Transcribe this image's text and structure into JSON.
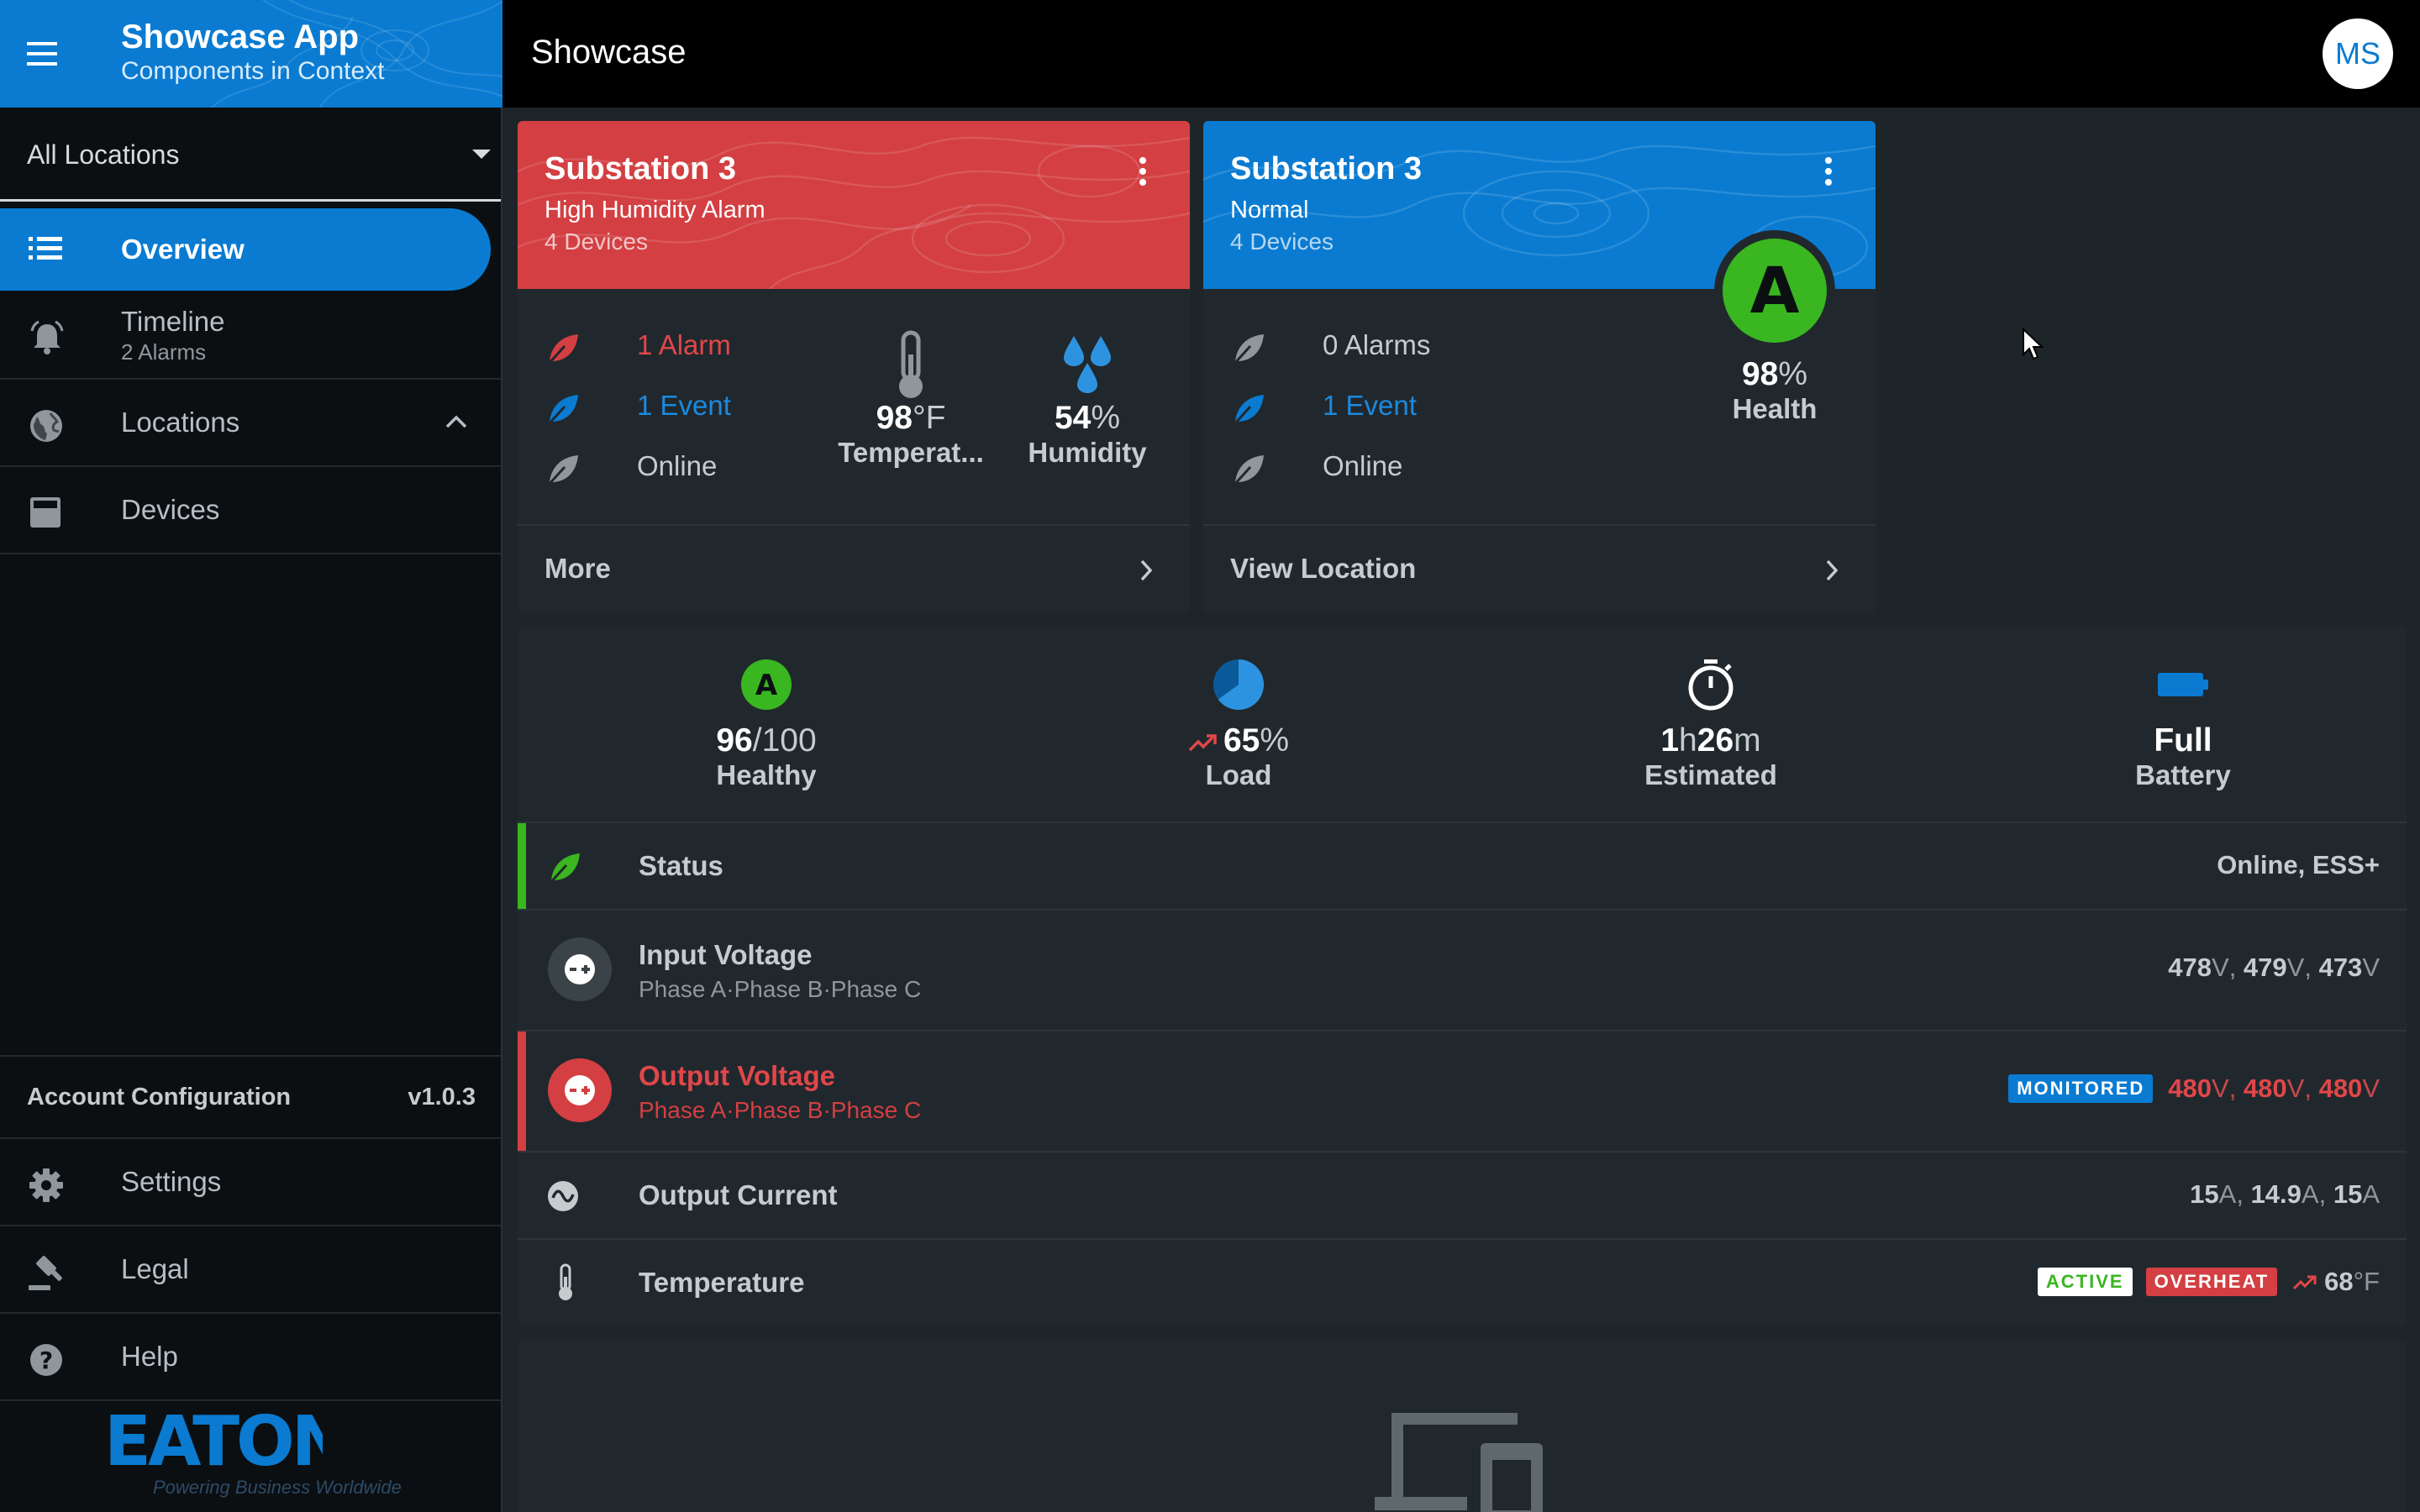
{
  "app": {
    "title": "Showcase App",
    "subtitle": "Components in Context",
    "page_title": "Showcase",
    "avatar_initials": "MS"
  },
  "sidebar": {
    "location_select": "All Locations",
    "items": [
      {
        "label": "Overview",
        "icon": "list-icon",
        "active": true
      },
      {
        "label": "Timeline",
        "sub": "2 Alarms",
        "icon": "alarm-bell-icon"
      },
      {
        "label": "Locations",
        "icon": "globe-icon"
      },
      {
        "label": "Devices",
        "icon": "device-icon"
      }
    ],
    "account_label": "Account Configuration",
    "version": "v1.0.3",
    "footer_items": [
      {
        "label": "Settings",
        "icon": "gear-icon"
      },
      {
        "label": "Legal",
        "icon": "gavel-icon"
      },
      {
        "label": "Help",
        "icon": "help-icon"
      }
    ],
    "logo_text": "EATON",
    "logo_tagline": "Powering Business Worldwide"
  },
  "cards": [
    {
      "title": "Substation 3",
      "subtitle": "High Humidity Alarm",
      "devices": "4 Devices",
      "rows": [
        "1 Alarm",
        "1 Event",
        "Online"
      ],
      "metrics": [
        {
          "value": "98",
          "unit": "°F",
          "label": "Temperat..."
        },
        {
          "value": "54",
          "unit": "%",
          "label": "Humidity"
        }
      ],
      "footer": "More"
    },
    {
      "title": "Substation 3",
      "subtitle": "Normal",
      "devices": "4 Devices",
      "rows": [
        "0 Alarms",
        "1 Event",
        "Online"
      ],
      "grade": "A",
      "health_value": "98",
      "health_unit": "%",
      "health_label": "Health",
      "footer": "View Location"
    }
  ],
  "kpis": [
    {
      "value": "96",
      "unit": "/100",
      "label": "Healthy",
      "icon": "grade-a-icon",
      "grade": "A"
    },
    {
      "value": "65",
      "unit": "%",
      "label": "Load",
      "icon": "pie-icon",
      "load_fraction": 0.65
    },
    {
      "value1": "1",
      "unit1": "h",
      "value2": "26",
      "unit2": "m",
      "label": "Estimated",
      "icon": "timer-icon"
    },
    {
      "value": "Full",
      "label": "Battery",
      "icon": "battery-icon"
    }
  ],
  "list": {
    "status": {
      "title": "Status",
      "value": "Online, ESS+"
    },
    "input_voltage": {
      "title": "Input Voltage",
      "sub": "Phase A·Phase B·Phase C",
      "v": [
        "478",
        "479",
        "473"
      ],
      "unit": "V"
    },
    "output_voltage": {
      "title": "Output Voltage",
      "sub": "Phase A·Phase B·Phase C",
      "chip": "MONITORED",
      "v": [
        "480",
        "480",
        "480"
      ],
      "unit": "V"
    },
    "output_current": {
      "title": "Output Current",
      "v": [
        "15",
        "14.9",
        "15"
      ],
      "unit": "A"
    },
    "temperature": {
      "title": "Temperature",
      "chip1": "ACTIVE",
      "chip2": "OVERHEAT",
      "value": "68",
      "unit": "°F"
    }
  },
  "colors": {
    "blue": "#0a7bd1",
    "red": "#d33f42",
    "green": "#39b620",
    "bg": "#1d2529",
    "card": "#21282d"
  }
}
